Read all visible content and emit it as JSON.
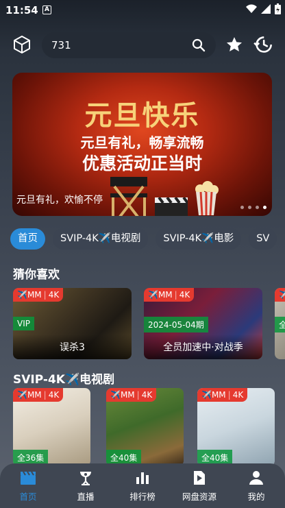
{
  "status_bar": {
    "time": "11:54",
    "app_badge": "A"
  },
  "search": {
    "value": "731"
  },
  "banner": {
    "headline": "元旦快乐",
    "line1": "元旦有礼，畅享流畅",
    "line2": "优惠活动正当时",
    "caption": "元旦有礼，欢愉不停",
    "dots": 4,
    "active_dot": 3
  },
  "tabs": [
    {
      "label": "首页",
      "active": true
    },
    {
      "label": "SVIP-4K✈️电视剧",
      "active": false
    },
    {
      "label": "SVIP-4K✈️电影",
      "active": false
    },
    {
      "label": "SV",
      "active": false
    }
  ],
  "section_guess": {
    "title": "猜你喜欢",
    "cards": [
      {
        "source": "✈️MM",
        "quality": "4K",
        "tag": "VIP",
        "title": "误杀3"
      },
      {
        "source": "✈️MM",
        "quality": "4K",
        "tag": "2024-05-04期",
        "title": "全员加速中·对战季"
      },
      {
        "source": "✈️",
        "quality": "",
        "tag": "全",
        "title": ""
      }
    ]
  },
  "section_tv": {
    "title": "SVIP-4K✈️电视剧",
    "cards": [
      {
        "source": "✈️MM",
        "quality": "4K",
        "episodes": "全36集"
      },
      {
        "source": "✈️MM",
        "quality": "4K",
        "episodes": "全40集"
      },
      {
        "source": "✈️MM",
        "quality": "4K",
        "episodes": "全40集"
      }
    ]
  },
  "bottom_nav": [
    {
      "label": "首页",
      "icon": "clapperboard-icon",
      "active": true
    },
    {
      "label": "直播",
      "icon": "satellite-dish-icon",
      "active": false
    },
    {
      "label": "排行榜",
      "icon": "bar-chart-icon",
      "active": false
    },
    {
      "label": "网盘资源",
      "icon": "play-file-icon",
      "active": false
    },
    {
      "label": "我的",
      "icon": "person-icon",
      "active": false
    }
  ],
  "colors": {
    "accent": "#2a8bd8",
    "badge": "#e53a2f",
    "tag_green": "#0a963c",
    "title_gold": "#f7d27a"
  }
}
